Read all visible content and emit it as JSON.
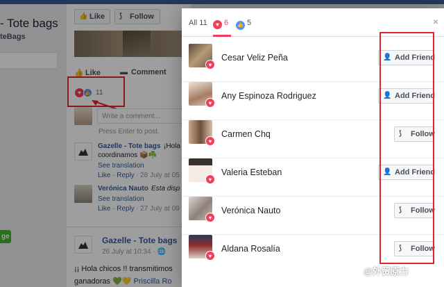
{
  "background": {
    "page_name": "- Tote bags",
    "page_handle": "teBags",
    "green_button": "ge",
    "like_btn": "Like",
    "follow_btn": "Follow",
    "actions": {
      "like": "Like",
      "comment": "Comment"
    },
    "reactions_count": "11",
    "comment_placeholder": "Write a comment...",
    "press_enter": "Press Enter to post.",
    "comments": [
      {
        "name": "Gazelle - Tote bags",
        "text1": "¡Hola",
        "text2": "coordinamos 📦☘️",
        "translate": "See translation",
        "meta_links": "Like · Reply",
        "meta_date": "· 28 July at 05"
      },
      {
        "name": "Verónica Nauto",
        "text1": "Esta disp",
        "translate": "See translation",
        "meta_links": "Like · Reply",
        "meta_date": "· 27 July at 09"
      }
    ],
    "post2": {
      "name": "Gazelle - Tote bags",
      "date": "26 July at 10:34 · 🌐",
      "text1": "¡¡ Hola chicos !! transmitimos",
      "text2_a": "ganadoras 💚💛 ",
      "text2_link": "Priscilla Ro"
    }
  },
  "dialog": {
    "tabs": [
      {
        "label": "All 11"
      },
      {
        "label": "6",
        "icon": "heart-icon"
      },
      {
        "label": "5",
        "icon": "like-icon"
      }
    ],
    "close_label": "×",
    "people": [
      {
        "name": "Cesar Veliz Peña",
        "action": "Add Friend",
        "action_icon": "add-friend-icon"
      },
      {
        "name": "Any Espinoza Rodriguez",
        "action": "Add Friend",
        "action_icon": "add-friend-icon"
      },
      {
        "name": "Carmen Chq",
        "action": "Follow",
        "action_icon": "follow-icon"
      },
      {
        "name": "Valeria Esteban",
        "action": "Add Friend",
        "action_icon": "add-friend-icon"
      },
      {
        "name": "Verónica Nauto",
        "action": "Follow",
        "action_icon": "follow-icon"
      },
      {
        "name": "Aldana Rosalía",
        "action": "Follow",
        "action_icon": "follow-icon"
      }
    ]
  },
  "watermark": "@外贸原力",
  "colors": {
    "heart": "#f33e58",
    "like": "#5890ff",
    "highlight": "#e0242c",
    "link": "#365899"
  }
}
